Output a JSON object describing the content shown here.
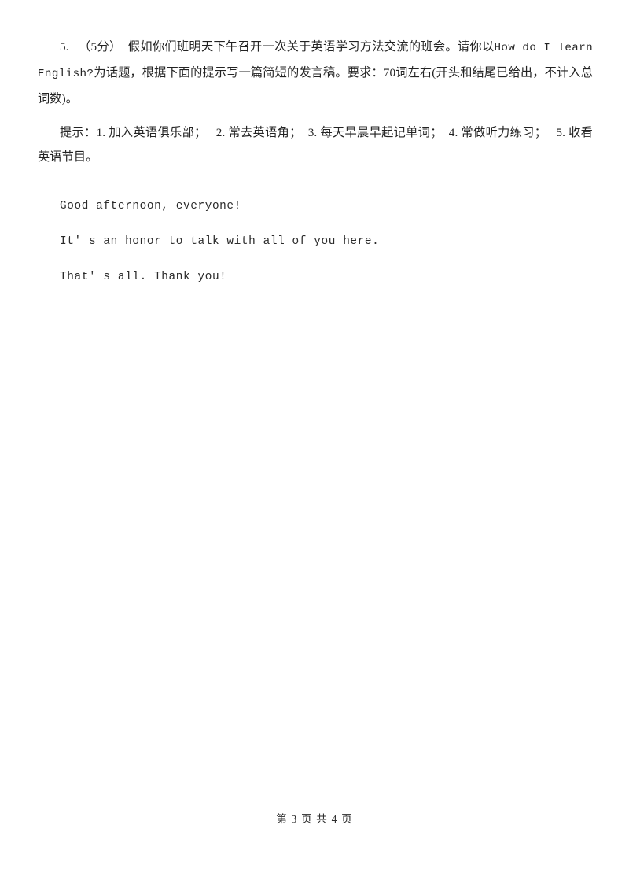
{
  "document": {
    "page_background": "#ffffff",
    "text_color": "#232323"
  },
  "question": {
    "number": "5.",
    "score": "（5分）",
    "stem_part1": "假如你们班明天下午召开一次关于英语学习方法交流的班会。请你以",
    "stem_topic_en": "How do I learn English?",
    "stem_part2": "为话题，根据下面的提示写一篇简短的发言稿。要求：",
    "stem_words_count": "70",
    "stem_part3": "词左右(开头和结尾已给出，不计入总词数)。"
  },
  "hints": {
    "label": "提示：",
    "items": [
      {
        "no": "1.",
        "text": "加入英语俱乐部；"
      },
      {
        "no": "2.",
        "text": "常去英语角；"
      },
      {
        "no": "3.",
        "text": "每天早晨早起记单词；"
      },
      {
        "no": "4.",
        "text": "常做听力练习；"
      },
      {
        "no": "5.",
        "text": "收看英语节目。"
      }
    ]
  },
  "speech": {
    "lines": [
      "Good afternoon, everyone!",
      "It' s an honor to talk with all of you here.",
      "That' s all. Thank you!"
    ]
  },
  "footer": {
    "prefix": "第",
    "current_page": "3",
    "middle": "页 共",
    "total_pages": "4",
    "suffix": "页"
  }
}
